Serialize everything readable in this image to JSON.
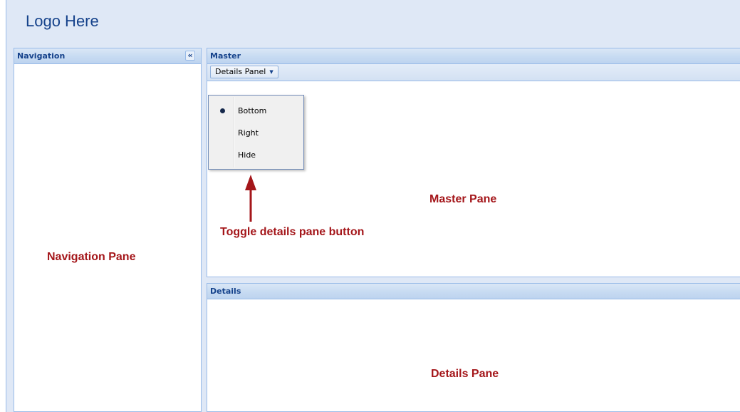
{
  "header": {
    "logo_text": "Logo Here"
  },
  "navigation": {
    "title": "Navigation",
    "collapse_glyph": "«",
    "pane_label": "Navigation Pane"
  },
  "master": {
    "title": "Master",
    "toolbar": {
      "details_button_label": "Details Panel",
      "details_button_arrow": "▼"
    },
    "pane_label": "Master Pane"
  },
  "menu": {
    "items": [
      {
        "label": "Bottom",
        "selected": true
      },
      {
        "label": "Right",
        "selected": false
      },
      {
        "label": "Hide",
        "selected": false
      }
    ]
  },
  "annotation": {
    "text": "Toggle details pane button",
    "color": "#a4161a"
  },
  "details": {
    "title": "Details",
    "pane_label": "Details Pane"
  },
  "colors": {
    "header_text": "#15428b",
    "border": "#99bbe8",
    "background": "#dfe8f6",
    "label_red": "#a4161a"
  },
  "icons": {
    "collapse": "double-chevron-left-icon",
    "dropdown": "triangle-down-icon",
    "radio": "radio-dot-icon"
  }
}
